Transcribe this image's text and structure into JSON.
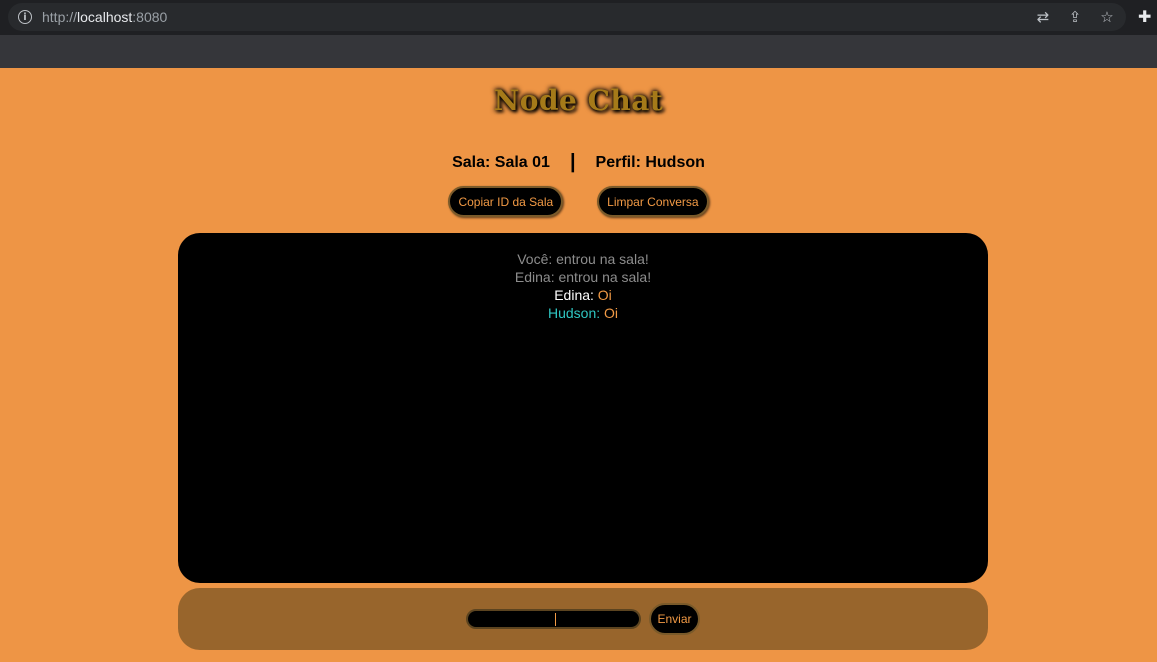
{
  "browser": {
    "url_scheme": "http://",
    "url_host": "localhost",
    "url_port": ":8080",
    "icons": [
      "translate-icon",
      "share-icon",
      "star-icon",
      "extensions-icon"
    ]
  },
  "page": {
    "title": "Node Chat",
    "room_label": "Sala: Sala 01",
    "separator": "|",
    "profile_label": "Perfil: Hudson",
    "copy_button": "Copiar ID da Sala",
    "clear_button": "Limpar Conversa",
    "send_button": "Enviar"
  },
  "messages": [
    {
      "type": "system",
      "text": "Você: entrou na sala!"
    },
    {
      "type": "system",
      "text": "Edina: entrou na sala!"
    },
    {
      "type": "chat",
      "user": "Edina:",
      "text": "Oi"
    },
    {
      "type": "chat",
      "user": "Hudson:",
      "text": "Oi"
    }
  ],
  "colors": {
    "background": "#ee9545",
    "accent": "#f29a45",
    "chat_bg": "#000000",
    "input_bar": "#98652c",
    "other_user": "#ffffff",
    "self_user": "#2fc6c2",
    "system": "#8d8d8d"
  }
}
